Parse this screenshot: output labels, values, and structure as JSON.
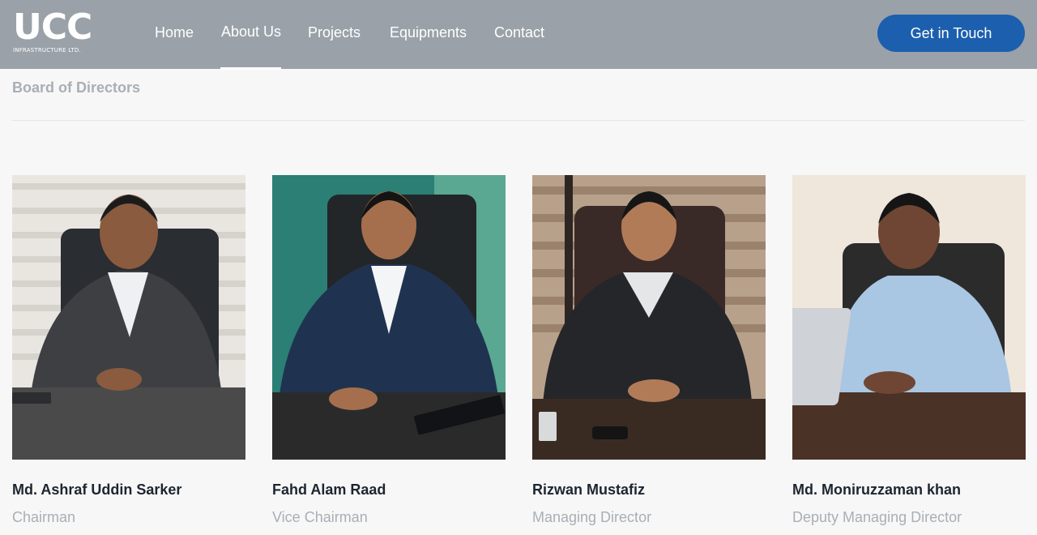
{
  "brand": {
    "logo_text": "UCC",
    "logo_subtitle": "INFRASTRUCTURE LTD."
  },
  "nav": {
    "items": [
      {
        "label": "Home"
      },
      {
        "label": "About Us",
        "active": true
      },
      {
        "label": "Projects"
      },
      {
        "label": "Equipments"
      },
      {
        "label": "Contact"
      }
    ],
    "cta_label": "Get in Touch"
  },
  "section": {
    "title": "Board of Directors"
  },
  "directors": [
    {
      "name": "Md. Ashraf Uddin Sarker",
      "role": "Chairman"
    },
    {
      "name": "Fahd Alam Raad",
      "role": "Vice Chairman"
    },
    {
      "name": "Rizwan Mustafiz",
      "role": "Managing Director"
    },
    {
      "name": "Md. Moniruzzaman khan",
      "role": "Deputy Managing Director"
    }
  ],
  "colors": {
    "navbar": "#9aa1a9",
    "cta": "#1c5fae",
    "muted_text": "#a9afb6",
    "name_text": "#1d2530"
  }
}
